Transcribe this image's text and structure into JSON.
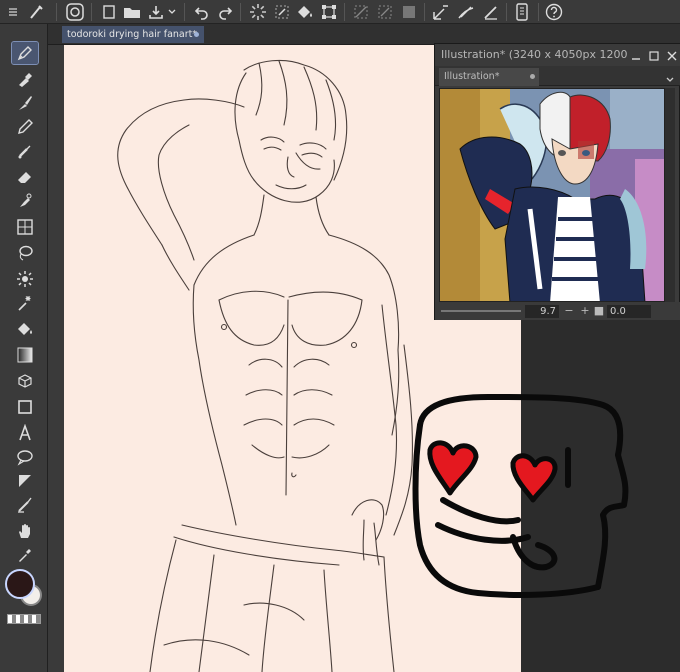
{
  "document_tab": {
    "title": "todoroki drying hair fanart*"
  },
  "navigator": {
    "window_title": "Illustration* (3240 x 4050px 1200c",
    "tab_label": "Illustration*",
    "zoom_value": "9.7",
    "rotation_value": "0.0"
  },
  "toolbar": {
    "icons": [
      "menu-icon",
      "brush-icon",
      "clip-studio-icon",
      "new-file-icon",
      "open-folder-icon",
      "save-icon",
      "undo-icon",
      "redo-icon",
      "loading-icon",
      "clear-icon",
      "fill-icon",
      "transform-icon",
      "deselect-icon",
      "invert-selection-icon",
      "selection-border-icon",
      "snap-ruler-icon",
      "snap-special-ruler-icon",
      "snap-grid-icon",
      "smartphone-icon",
      "help-icon"
    ]
  },
  "tools": {
    "icons": [
      "pen-tool-icon",
      "eyedropper-icon",
      "brush-icon",
      "pencil-icon",
      "airbrush-icon",
      "eraser-icon",
      "decoration-icon",
      "frame-icon",
      "lasso-icon",
      "auto-select-icon",
      "magic-wand-icon",
      "fill-icon",
      "gradient-icon",
      "3d-object-icon",
      "rectangle-icon",
      "text-icon",
      "balloon-icon",
      "ruler-icon",
      "correct-line-icon",
      "hand-icon",
      "color-picker-icon"
    ]
  },
  "colors": {
    "canvas_bg": "#fcebe2",
    "accent_red": "#e4181f",
    "tab_active": "#45526c",
    "main_color": "#2a1717",
    "sub_color": "#f2eeea"
  }
}
